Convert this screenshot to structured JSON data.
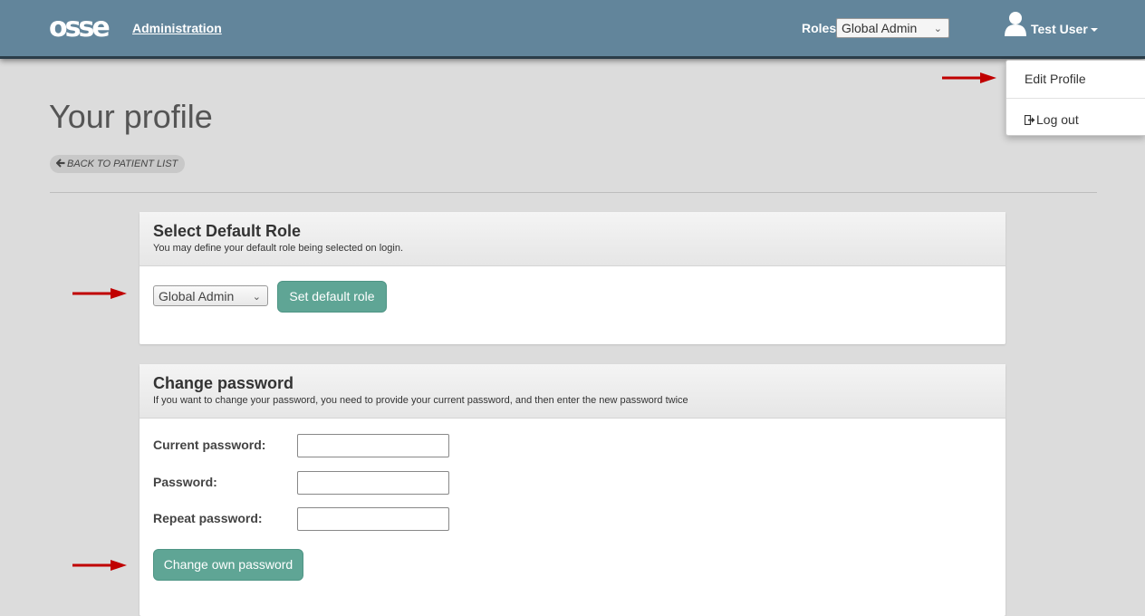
{
  "navbar": {
    "logo_text": "osse",
    "admin_link": "Administration",
    "roles_label": "Roles",
    "roles_selected": "Global Admin",
    "user_name": "Test User"
  },
  "user_menu": {
    "edit_profile": "Edit Profile",
    "log_out": "Log out"
  },
  "page": {
    "title": "Your profile",
    "back_link": "BACK TO PATIENT LIST"
  },
  "default_role_panel": {
    "title": "Select Default Role",
    "subtitle": "You may define your default role being selected on login.",
    "selected_role": "Global Admin",
    "button": "Set default role"
  },
  "password_panel": {
    "title": "Change password",
    "subtitle": "If you want to change your password, you need to provide your current password, and then enter the new password twice",
    "fields": [
      {
        "label": "Current password:",
        "value": ""
      },
      {
        "label": "Password:",
        "value": ""
      },
      {
        "label": "Repeat password:",
        "value": ""
      }
    ],
    "button": "Change own password"
  },
  "colors": {
    "navbar": "#62859b",
    "button": "#5fa595",
    "annotation_arrow": "#c00000"
  },
  "icons": [
    "user-icon",
    "caret-down-icon",
    "sign-out-icon",
    "arrow-left-icon",
    "chevron-down-icon"
  ]
}
